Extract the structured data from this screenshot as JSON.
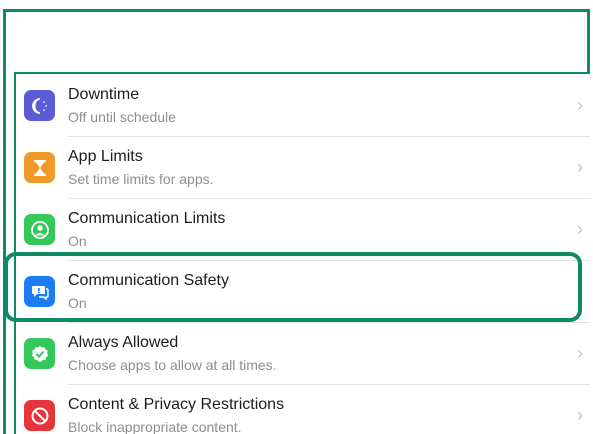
{
  "settings": {
    "items": [
      {
        "title": "Downtime",
        "subtitle": "Off until schedule",
        "icon": "downtime-icon",
        "color": "#5b5bd6"
      },
      {
        "title": "App Limits",
        "subtitle": "Set time limits for apps.",
        "icon": "hourglass-icon",
        "color": "#f09a2b"
      },
      {
        "title": "Communication Limits",
        "subtitle": "On",
        "icon": "person-circle-icon",
        "color": "#34c759"
      },
      {
        "title": "Communication Safety",
        "subtitle": "On",
        "icon": "chat-bubble-icon",
        "color": "#1e7cf2"
      },
      {
        "title": "Always Allowed",
        "subtitle": "Choose apps to allow at all times.",
        "icon": "checkmark-shield-icon",
        "color": "#34c759"
      },
      {
        "title": "Content & Privacy Restrictions",
        "subtitle": "Block inappropriate content.",
        "icon": "no-entry-icon",
        "color": "#e5353b"
      }
    ],
    "chevron": "›"
  },
  "accent_colors": {
    "highlight": "#0f8a66"
  }
}
